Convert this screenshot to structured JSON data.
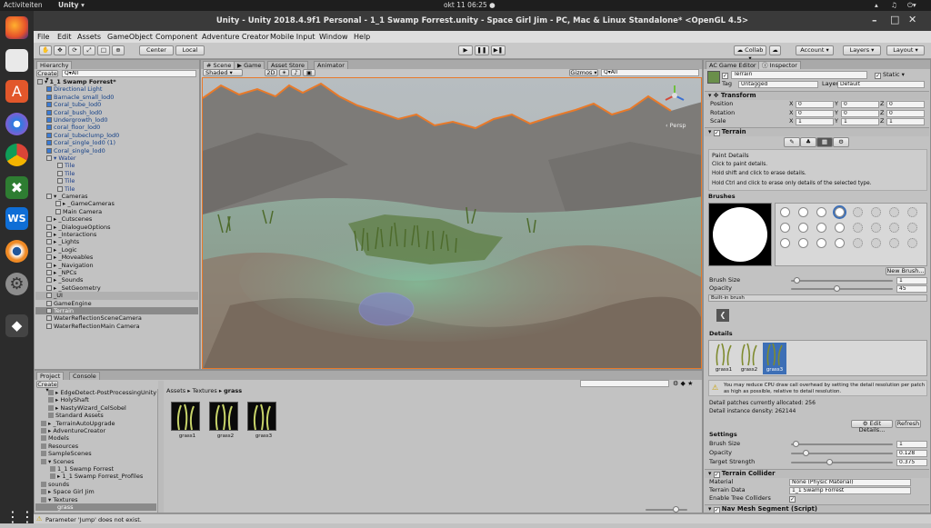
{
  "topbar": {
    "activities": "Activiteiten",
    "app": "Unity ▾",
    "clock": "okt 11  06:25 ●"
  },
  "window": {
    "title": "Unity - Unity 2018.4.9f1 Personal - 1_1 Swamp Forrest.unity - Space Girl Jim - PC, Mac & Linux Standalone* <OpenGL 4.5>"
  },
  "menu": [
    "File",
    "Edit",
    "Assets",
    "GameObject",
    "Component",
    "Adventure Creator",
    "Mobile Input",
    "Window",
    "Help"
  ],
  "toolbar": {
    "center": "Center",
    "local": "Local",
    "collab": "☁ Collab ▾",
    "account": "Account ▾",
    "layers": "Layers ▾",
    "layout": "Layout ▾"
  },
  "hierarchy": {
    "tab": "Hierarchy",
    "create": "Create ▾",
    "search": "Q▾All",
    "items": [
      "▾ 1_1 Swamp Forrest*",
      "Directional Light",
      "Barnacle_small_lod0",
      "Coral_tube_lod0",
      "Coral_bush_lod0",
      "Undergrowth_lod0",
      "coral_floor_lod0",
      "Coral_tubeclump_lod0",
      "Coral_single_lod0 (1)",
      "Coral_single_lod0",
      "▾ Water",
      "Tile",
      "Tile",
      "Tile",
      "Tile",
      "▾ _Cameras",
      "▸ _GameCameras",
      "Main Camera",
      "▸ _Cutscenes",
      "▸ _DialogueOptions",
      "▸ _Interactions",
      "▸ _Lights",
      "▸ _Logic",
      "▸ _Moveables",
      "▸ _Navigation",
      "▸ _NPCs",
      "▸ _Sounds",
      "▸ _SetGeometry",
      "_UI",
      "GameEngine",
      "Terrain",
      "WaterReflectionSceneCamera",
      "WaterReflectionMain Camera"
    ]
  },
  "scene": {
    "tabs": [
      "# Scene",
      "▶ Game",
      "Asset Store",
      "Animator"
    ],
    "shaded": "Shaded ▾",
    "mode2d": "2D",
    "gizmos": "Gizmos ▾",
    "search": "Q▾All",
    "persp": "‹ Persp"
  },
  "project": {
    "tabs": [
      "Project",
      "Console"
    ],
    "create": "Create ▾",
    "breadcrumb": [
      "Assets",
      "Textures",
      "grass"
    ],
    "folders": [
      "▸ EdgeDetect-PostProcessingUnity",
      "▸ HolyShaft",
      "▸ NastyWizard_CelSobel",
      "Standard Assets",
      "▸ _TerrainAutoUpgrade",
      "▸ AdventureCreator",
      "Models",
      "Resources",
      "SampleScenes",
      "▾ Scenes",
      "1_1 Swamp Forrest",
      "▸ 1_1 Swamp Forrest_Profiles",
      "sounds",
      "▸ Space Girl Jim",
      "▾ Textures",
      "grass"
    ],
    "assets": [
      "grass1",
      "grass2",
      "grass3"
    ]
  },
  "status": {
    "message": "Parameter 'Jump' does not exist."
  },
  "inspector": {
    "tabs": [
      "AC Game Editor",
      "ⓘ Inspector"
    ],
    "object": "Terrain",
    "static": "Static ▾",
    "tag_label": "Tag",
    "tag": "Untagged",
    "layer_label": "Layer",
    "layer": "Default",
    "transform": {
      "title": "Transform",
      "rows": [
        {
          "label": "Position",
          "x": "0",
          "y": "0",
          "z": "0"
        },
        {
          "label": "Rotation",
          "x": "0",
          "y": "0",
          "z": "0"
        },
        {
          "label": "Scale",
          "x": "1",
          "y": "1",
          "z": "1"
        }
      ]
    },
    "terrain": {
      "title": "Terrain",
      "paint_title": "Paint Details",
      "paint_lines": [
        "Click to paint details.",
        "Hold shift and click to erase details.",
        "Hold Ctrl and click to erase only details of the selected type."
      ],
      "brushes_label": "Brushes",
      "new_brush": "New Brush...",
      "brush_size_label": "Brush Size",
      "brush_size": "1",
      "brush_size_pct": 0.03,
      "opacity_label": "Opacity",
      "opacity": "45",
      "opacity_pct": 0.45,
      "builtin": "Built-in brush",
      "details_label": "Details",
      "details": [
        "grass1",
        "grass2",
        "grass3"
      ],
      "warning": "You may reduce CPU draw call overhead by setting the detail resolution per patch as high as possible, relative to detail resolution.",
      "patches": "Detail patches currently allocated: 256",
      "density": "Detail instance density: 262144",
      "edit_details": "⚙ Edit Details...",
      "refresh": "Refresh",
      "settings_label": "Settings",
      "s_brush_label": "Brush Size",
      "s_brush": "1",
      "s_brush_pct": 0.02,
      "s_opacity_label": "Opacity",
      "s_opacity": "0.128",
      "s_opacity_pct": 0.128,
      "s_target_label": "Target Strength",
      "s_target": "0.375",
      "s_target_pct": 0.375
    },
    "collider": {
      "title": "Terrain Collider",
      "material_label": "Material",
      "material": "None (Physic Material)",
      "data_label": "Terrain Data",
      "data": "1_1 Swamp Forrest",
      "trees_label": "Enable Tree Colliders"
    },
    "navmesh": {
      "title": "Nav Mesh Segment (Script)"
    }
  },
  "colors": {
    "accent": "#3d6fb6",
    "selection": "#8a8a8a",
    "sky": "#b7bdc0",
    "mountain": "#7d7b78",
    "orange_outline": "#e87a2a"
  }
}
